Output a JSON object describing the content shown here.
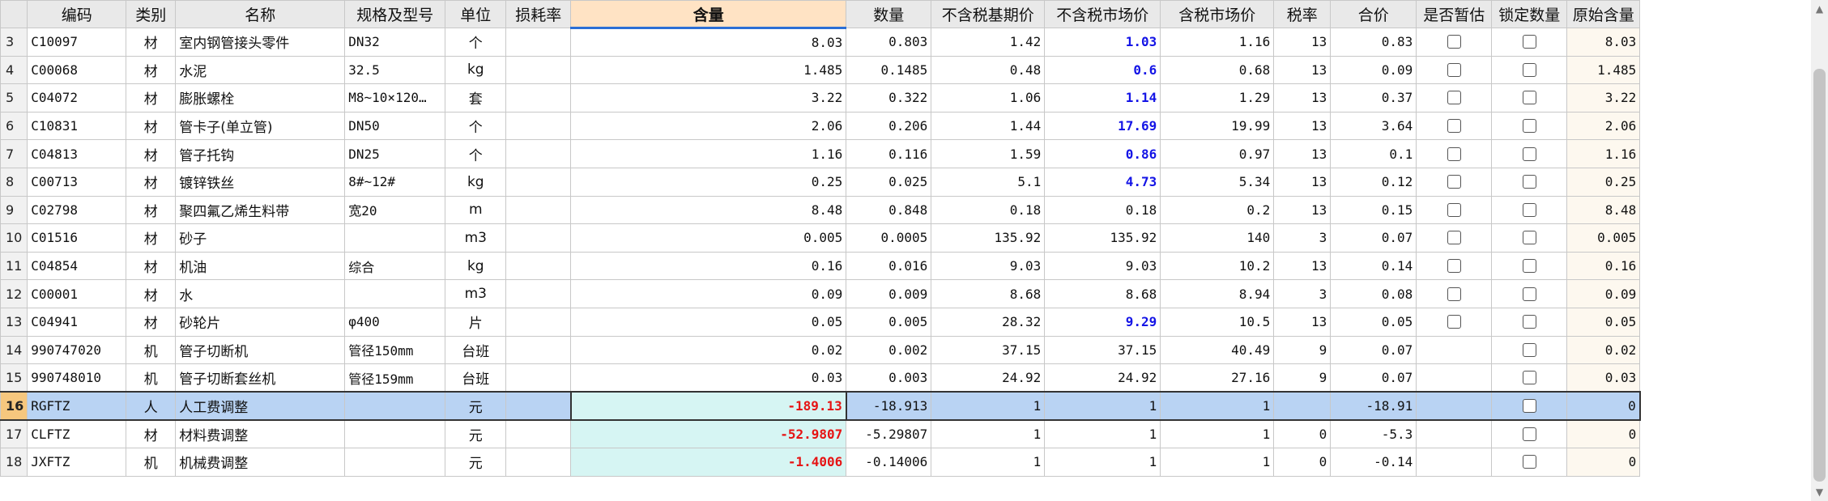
{
  "columns": [
    "编码",
    "类别",
    "名称",
    "规格及型号",
    "单位",
    "损耗率",
    "含量",
    "数量",
    "不含税基期价",
    "不含税市场价",
    "含税市场价",
    "税率",
    "合价",
    "是否暂估",
    "锁定数量",
    "原始含量"
  ],
  "rows": [
    {
      "rn": "3",
      "code": "C10097",
      "type": "材",
      "name": "室内钢管接头零件",
      "spec": "DN32",
      "unit": "个",
      "loss": "",
      "content": "8.03",
      "qty": "0.803",
      "base": "1.42",
      "market": "1.03",
      "market_blue": true,
      "taxmkt": "1.16",
      "tax": "13",
      "total": "0.83",
      "est": true,
      "lock": true,
      "orig": "8.03"
    },
    {
      "rn": "4",
      "code": "C00068",
      "type": "材",
      "name": "水泥",
      "spec": "32.5",
      "unit": "kg",
      "loss": "",
      "content": "1.485",
      "qty": "0.1485",
      "base": "0.48",
      "market": "0.6",
      "market_blue": true,
      "taxmkt": "0.68",
      "tax": "13",
      "total": "0.09",
      "est": true,
      "lock": true,
      "orig": "1.485"
    },
    {
      "rn": "5",
      "code": "C04072",
      "type": "材",
      "name": "膨胀螺栓",
      "spec": "M8~10×120…",
      "unit": "套",
      "loss": "",
      "content": "3.22",
      "qty": "0.322",
      "base": "1.06",
      "market": "1.14",
      "market_blue": true,
      "taxmkt": "1.29",
      "tax": "13",
      "total": "0.37",
      "est": true,
      "lock": true,
      "orig": "3.22"
    },
    {
      "rn": "6",
      "code": "C10831",
      "type": "材",
      "name": "管卡子(单立管)",
      "spec": "DN50",
      "unit": "个",
      "loss": "",
      "content": "2.06",
      "qty": "0.206",
      "base": "1.44",
      "market": "17.69",
      "market_blue": true,
      "taxmkt": "19.99",
      "tax": "13",
      "total": "3.64",
      "est": true,
      "lock": true,
      "orig": "2.06"
    },
    {
      "rn": "7",
      "code": "C04813",
      "type": "材",
      "name": "管子托钩",
      "spec": "DN25",
      "unit": "个",
      "loss": "",
      "content": "1.16",
      "qty": "0.116",
      "base": "1.59",
      "market": "0.86",
      "market_blue": true,
      "taxmkt": "0.97",
      "tax": "13",
      "total": "0.1",
      "est": true,
      "lock": true,
      "orig": "1.16"
    },
    {
      "rn": "8",
      "code": "C00713",
      "type": "材",
      "name": "镀锌铁丝",
      "spec": "8#~12#",
      "unit": "kg",
      "loss": "",
      "content": "0.25",
      "qty": "0.025",
      "base": "5.1",
      "market": "4.73",
      "market_blue": true,
      "taxmkt": "5.34",
      "tax": "13",
      "total": "0.12",
      "est": true,
      "lock": true,
      "orig": "0.25"
    },
    {
      "rn": "9",
      "code": "C02798",
      "type": "材",
      "name": "聚四氟乙烯生料带",
      "spec": "宽20",
      "unit": "m",
      "loss": "",
      "content": "8.48",
      "qty": "0.848",
      "base": "0.18",
      "market": "0.18",
      "market_blue": false,
      "taxmkt": "0.2",
      "tax": "13",
      "total": "0.15",
      "est": true,
      "lock": true,
      "orig": "8.48"
    },
    {
      "rn": "10",
      "code": "C01516",
      "type": "材",
      "name": "砂子",
      "spec": "",
      "unit": "m3",
      "loss": "",
      "content": "0.005",
      "qty": "0.0005",
      "base": "135.92",
      "market": "135.92",
      "market_blue": false,
      "taxmkt": "140",
      "tax": "3",
      "total": "0.07",
      "est": true,
      "lock": true,
      "orig": "0.005"
    },
    {
      "rn": "11",
      "code": "C04854",
      "type": "材",
      "name": "机油",
      "spec": "综合",
      "unit": "kg",
      "loss": "",
      "content": "0.16",
      "qty": "0.016",
      "base": "9.03",
      "market": "9.03",
      "market_blue": false,
      "taxmkt": "10.2",
      "tax": "13",
      "total": "0.14",
      "est": true,
      "lock": true,
      "orig": "0.16"
    },
    {
      "rn": "12",
      "code": "C00001",
      "type": "材",
      "name": "水",
      "spec": "",
      "unit": "m3",
      "loss": "",
      "content": "0.09",
      "qty": "0.009",
      "base": "8.68",
      "market": "8.68",
      "market_blue": false,
      "taxmkt": "8.94",
      "tax": "3",
      "total": "0.08",
      "est": true,
      "lock": true,
      "orig": "0.09"
    },
    {
      "rn": "13",
      "code": "C04941",
      "type": "材",
      "name": "砂轮片",
      "spec": "φ400",
      "unit": "片",
      "loss": "",
      "content": "0.05",
      "qty": "0.005",
      "base": "28.32",
      "market": "9.29",
      "market_blue": true,
      "taxmkt": "10.5",
      "tax": "13",
      "total": "0.05",
      "est": true,
      "lock": true,
      "orig": "0.05"
    },
    {
      "rn": "14",
      "code": "990747020",
      "type": "机",
      "name": "管子切断机",
      "spec": "管径150mm",
      "unit": "台班",
      "loss": "",
      "content": "0.02",
      "qty": "0.002",
      "base": "37.15",
      "market": "37.15",
      "market_blue": false,
      "taxmkt": "40.49",
      "tax": "9",
      "total": "0.07",
      "est": false,
      "lock": true,
      "orig": "0.02"
    },
    {
      "rn": "15",
      "code": "990748010",
      "type": "机",
      "name": "管子切断套丝机",
      "spec": "管径159mm",
      "unit": "台班",
      "loss": "",
      "content": "0.03",
      "qty": "0.003",
      "base": "24.92",
      "market": "24.92",
      "market_blue": false,
      "taxmkt": "27.16",
      "tax": "9",
      "total": "0.07",
      "est": false,
      "lock": true,
      "orig": "0.03"
    },
    {
      "rn": "16",
      "code": "RGFTZ",
      "type": "人",
      "name": "人工费调整",
      "spec": "",
      "unit": "元",
      "loss": "",
      "content": "-189.13",
      "qty": "-18.913",
      "base": "1",
      "market": "1",
      "market_blue": false,
      "taxmkt": "1",
      "tax": "",
      "total": "-18.91",
      "est": false,
      "lock": true,
      "orig": "0",
      "selected": true,
      "content_red": true
    },
    {
      "rn": "17",
      "code": "CLFTZ",
      "type": "材",
      "name": "材料费调整",
      "spec": "",
      "unit": "元",
      "loss": "",
      "content": "-52.9807",
      "qty": "-5.29807",
      "base": "1",
      "market": "1",
      "market_blue": false,
      "taxmkt": "1",
      "tax": "0",
      "total": "-5.3",
      "est": false,
      "lock": true,
      "orig": "0",
      "content_red": true
    },
    {
      "rn": "18",
      "code": "JXFTZ",
      "type": "机",
      "name": "机械费调整",
      "spec": "",
      "unit": "元",
      "loss": "",
      "content": "-1.4006",
      "qty": "-0.14006",
      "base": "1",
      "market": "1",
      "market_blue": false,
      "taxmkt": "1",
      "tax": "0",
      "total": "-0.14",
      "est": false,
      "lock": true,
      "orig": "0",
      "content_red": true
    }
  ],
  "icons": {
    "scroll_up": "▲",
    "scroll_down": "▼"
  },
  "colors": {
    "header_highlight": "#ffe3c4",
    "selected_row": "#b9d3f3",
    "blue_price": "#1414e6",
    "red_value": "#e61414",
    "tint": "#d6f5f3"
  }
}
